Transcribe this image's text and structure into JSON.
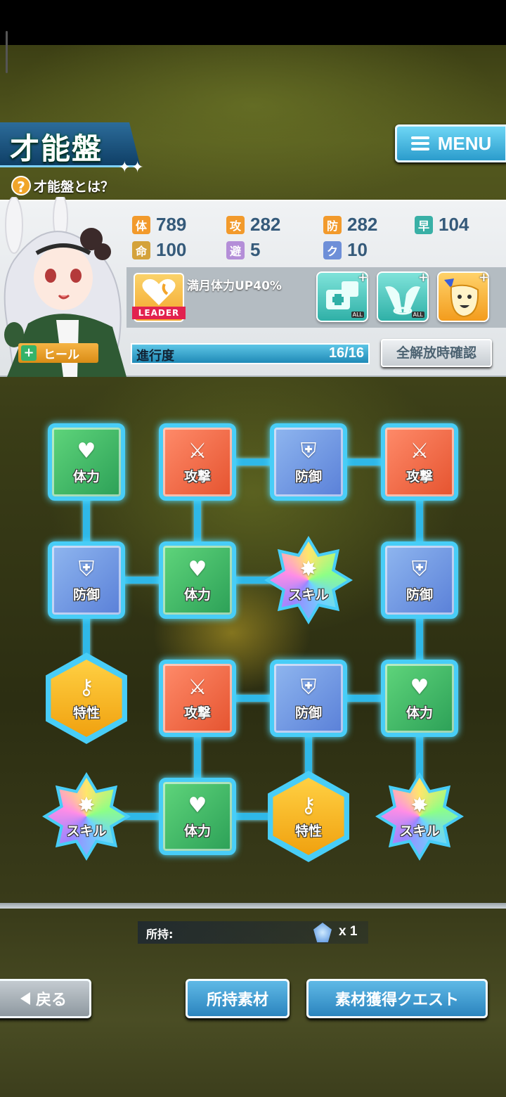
{
  "header": {
    "title": "才能盤",
    "help_text": "才能盤とは？",
    "menu_label": "MENU"
  },
  "stats": [
    {
      "icon": "体",
      "value": "789",
      "color": "#f29a2c"
    },
    {
      "icon": "攻",
      "value": "282",
      "color": "#f29a2c"
    },
    {
      "icon": "防",
      "value": "282",
      "color": "#f29a2c"
    },
    {
      "icon": "早",
      "value": "104",
      "color": "#39b0a6"
    },
    {
      "icon": "命",
      "value": "100",
      "color": "#d4a23a"
    },
    {
      "icon": "避",
      "value": "5",
      "color": "#b48ed8"
    },
    {
      "icon": "ク",
      "value": "10",
      "color": "#6e8fd8"
    }
  ],
  "leader": {
    "tag": "LEADER",
    "text": "満月体力UP40%"
  },
  "skills": [
    {
      "name": "medkit-all-icon",
      "badge": "ALL"
    },
    {
      "name": "wings-all-icon",
      "badge": "ALL"
    },
    {
      "name": "burst-face-icon",
      "badge": ""
    }
  ],
  "role": "ヒール",
  "progress": {
    "label": "進行度",
    "value": "16/16",
    "fraction": 1.0
  },
  "confirm_label": "全解放時確認",
  "nodes": [
    {
      "type": "green",
      "label": "体力",
      "glyph": "♥"
    },
    {
      "type": "red",
      "label": "攻撃",
      "glyph": "⚔"
    },
    {
      "type": "blue",
      "label": "防御",
      "glyph": "⛨"
    },
    {
      "type": "red",
      "label": "攻撃",
      "glyph": "⚔"
    },
    {
      "type": "blue",
      "label": "防御",
      "glyph": "⛨"
    },
    {
      "type": "green",
      "label": "体力",
      "glyph": "♥"
    },
    {
      "type": "star",
      "label": "スキル",
      "glyph": "✸"
    },
    {
      "type": "blue",
      "label": "防御",
      "glyph": "⛨"
    },
    {
      "type": "hex",
      "label": "特性",
      "glyph": "⚷"
    },
    {
      "type": "red",
      "label": "攻撃",
      "glyph": "⚔"
    },
    {
      "type": "blue",
      "label": "防御",
      "glyph": "⛨"
    },
    {
      "type": "green",
      "label": "体力",
      "glyph": "♥"
    },
    {
      "type": "star",
      "label": "スキル",
      "glyph": "✸"
    },
    {
      "type": "green",
      "label": "体力",
      "glyph": "♥"
    },
    {
      "type": "hex",
      "label": "特性",
      "glyph": "⚷"
    },
    {
      "type": "star",
      "label": "スキル",
      "glyph": "✸"
    }
  ],
  "owned": {
    "label": "所持:",
    "count": "x 1"
  },
  "buttons": {
    "back": "戻る",
    "materials": "所持素材",
    "quest": "素材獲得クエスト"
  }
}
